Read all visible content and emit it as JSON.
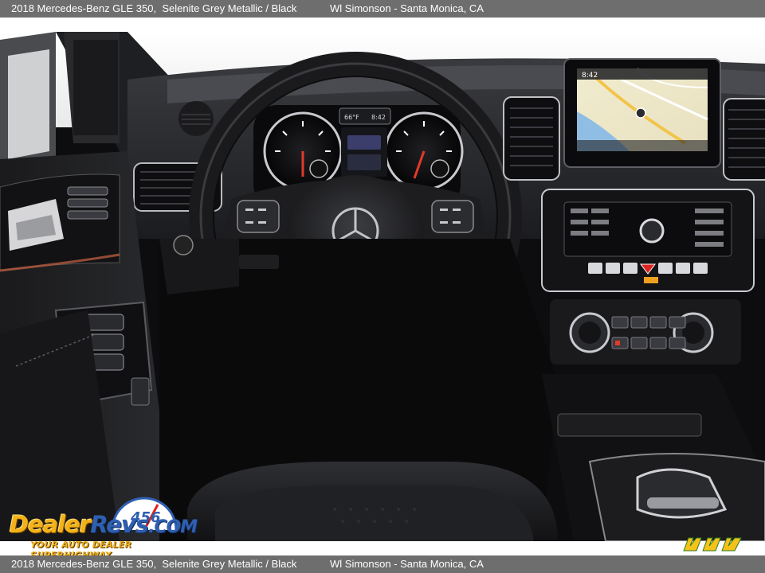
{
  "caption": {
    "vehicle": "2018 Mercedes-Benz GLE 350,  Selenite Grey Metallic / Black",
    "dealer": "Wl Simonson - Santa Monica, CA"
  },
  "photo": {
    "subject": "Mercedes-Benz GLE 350 dashboard with steering wheel, instrument cluster, infotainment screen and center console"
  },
  "watermark": {
    "brand_part1": "Dealer",
    "brand_part2": "Revs",
    "brand_part3": ".COM",
    "tagline": "YOUR AUTO DEALER SUPERHIGHWAY",
    "gauge_digits": "456"
  },
  "corner_logo": {
    "name": "wm-logo"
  },
  "screen": {
    "clock": "8:42"
  },
  "cluster": {
    "temp": "66°F",
    "time": "8:42"
  }
}
